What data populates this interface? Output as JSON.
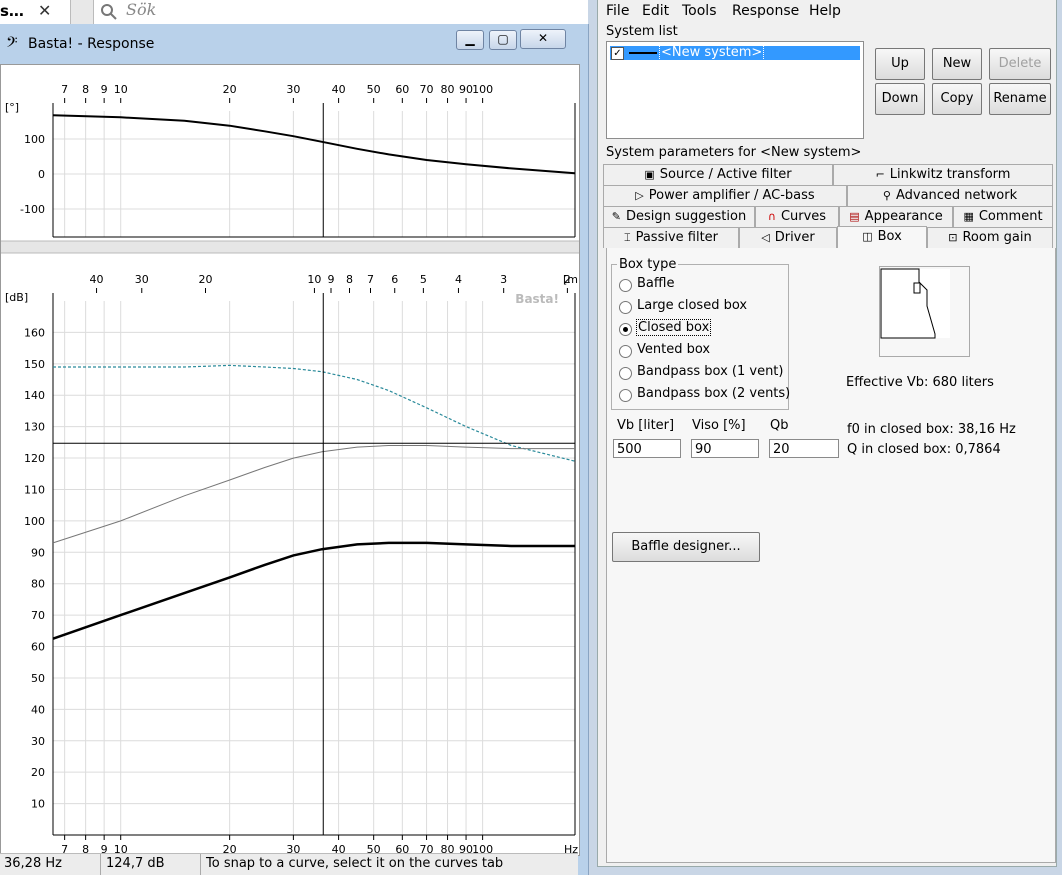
{
  "topbar": {
    "tab_label": "s…",
    "close_glyph": "✕",
    "search_placeholder": "Sök"
  },
  "response_window": {
    "title": "Basta! - Response",
    "icon": "bass-clef-icon",
    "phase_plot": {
      "ylabel": "[°]",
      "yticks": [
        "100",
        "0",
        "-100"
      ],
      "xticks": [
        "7",
        "8",
        "9",
        "10",
        "20",
        "30",
        "40",
        "50",
        "60",
        "70",
        "80",
        "90",
        "100"
      ]
    },
    "spl_plot": {
      "ylabel": "[dB]",
      "yticks": [
        "160",
        "150",
        "140",
        "130",
        "120",
        "110",
        "100",
        "90",
        "80",
        "70",
        "60",
        "50",
        "40",
        "30",
        "20",
        "10"
      ],
      "xticks": [
        "7",
        "8",
        "9",
        "10",
        "20",
        "30",
        "40",
        "50",
        "60",
        "70",
        "80",
        "90",
        "100"
      ],
      "xunit": "Hz",
      "top_ticks": [
        "40",
        "30",
        "20",
        "10",
        "9",
        "8",
        "7",
        "6",
        "5",
        "4",
        "3",
        "2"
      ],
      "top_unit": "[m]",
      "watermark": "Basta!"
    },
    "status": {
      "freq": "36,28 Hz",
      "level": "124,7 dB",
      "hint": "To snap to a curve, select it on the curves tab"
    }
  },
  "chart_data": [
    {
      "type": "line",
      "ylabel": "[°]",
      "xscale": "log",
      "xlim": [
        6.5,
        180
      ],
      "ylim": [
        -180,
        180
      ],
      "grid": true,
      "cursor_x": 36.28,
      "series": [
        {
          "x": [
            6.5,
            10,
            15,
            20,
            25,
            30,
            36,
            45,
            55,
            70,
            90,
            120,
            180
          ],
          "y": [
            168,
            162,
            152,
            138,
            122,
            108,
            92,
            72,
            56,
            40,
            28,
            16,
            2
          ]
        }
      ]
    },
    {
      "type": "line",
      "ylabel": "[dB]",
      "xscale": "log",
      "xlim": [
        6.5,
        180
      ],
      "ylim": [
        0,
        170
      ],
      "grid": true,
      "cursor_x": 36.28,
      "cursor_y": 124.7,
      "series": [
        {
          "style": "dashed",
          "x": [
            6.5,
            10,
            15,
            20,
            25,
            30,
            36,
            45,
            55,
            70,
            90,
            120,
            180
          ],
          "y": [
            149,
            149,
            149,
            149.5,
            149,
            148.5,
            147.5,
            145,
            141.5,
            136,
            130,
            124,
            119
          ]
        },
        {
          "style": "thin",
          "x": [
            6.5,
            10,
            15,
            20,
            25,
            30,
            36,
            45,
            55,
            70,
            90,
            120,
            180
          ],
          "y": [
            93,
            100,
            108,
            113,
            117,
            120,
            122,
            123.5,
            124,
            124,
            123.5,
            123,
            123
          ]
        },
        {
          "style": "thick",
          "x": [
            6.5,
            10,
            15,
            20,
            25,
            30,
            36,
            45,
            55,
            70,
            90,
            120,
            180
          ],
          "y": [
            62.5,
            70,
            77,
            82,
            86,
            89,
            91,
            92.5,
            93,
            93,
            92.5,
            92,
            92
          ]
        }
      ]
    }
  ],
  "menu": [
    "File",
    "Edit",
    "Tools",
    "Response",
    "Help"
  ],
  "system_list": {
    "label": "System list",
    "items": [
      {
        "name": "<New system>",
        "checked": true
      }
    ],
    "buttons": {
      "up": "Up",
      "new": "New",
      "delete": "Delete",
      "down": "Down",
      "copy": "Copy",
      "rename": "Rename"
    }
  },
  "params": {
    "label": "System parameters for <New system>",
    "tabs_row1": [
      "Source / Active filter",
      "Linkwitz transform"
    ],
    "tabs_row2": [
      "Power amplifier / AC-bass",
      "Advanced network"
    ],
    "tabs_row3": [
      "Design suggestion",
      "Curves",
      "Appearance",
      "Comment"
    ],
    "tabs_row4": [
      "Passive filter",
      "Driver",
      "Box",
      "Room gain"
    ],
    "active_tab": "Box"
  },
  "box": {
    "type_label": "Box type",
    "types": [
      "Baffle",
      "Large closed box",
      "Closed box",
      "Vented box",
      "Bandpass box (1 vent)",
      "Bandpass box (2 vents)"
    ],
    "selected": "Closed box",
    "effective_vb": "Effective Vb: 680 liters",
    "vb_label": "Vb [liter]",
    "vb_value": "500",
    "viso_label": "Viso [%]",
    "viso_value": "90",
    "qb_label": "Qb",
    "qb_value": "20",
    "f0": "f0 in closed box: 38,16 Hz",
    "q": "Q  in closed box: 0,7864",
    "baffle_btn": "Baffle designer..."
  }
}
